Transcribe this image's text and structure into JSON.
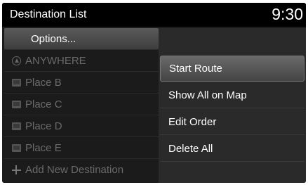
{
  "header": {
    "title": "Destination List",
    "clock": "9:30"
  },
  "list": {
    "options_label": "Options...",
    "items": [
      {
        "label": "ANYWHERE",
        "icon": "pin-icon"
      },
      {
        "label": "Place B",
        "icon": "flag-icon"
      },
      {
        "label": "Place C",
        "icon": "flag-icon"
      },
      {
        "label": "Place D",
        "icon": "flag-icon"
      },
      {
        "label": "Place E",
        "icon": "flag-icon"
      },
      {
        "label": "Add New Destination",
        "icon": "plus-icon"
      }
    ]
  },
  "menu": {
    "items": [
      {
        "label": "Start Route"
      },
      {
        "label": "Show All on Map"
      },
      {
        "label": "Edit Order"
      },
      {
        "label": "Delete All"
      }
    ]
  }
}
